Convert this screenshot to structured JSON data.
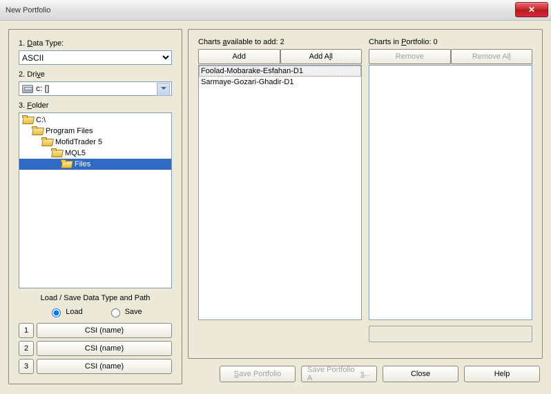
{
  "window": {
    "title": "New Portfolio"
  },
  "left": {
    "data_type_label": "1. Data Type:",
    "data_type_value": "ASCII",
    "drive_label": "2. Drive",
    "drive_value": "c: []",
    "folder_label": "3. Folder",
    "tree": [
      {
        "indent": 0,
        "label": "C:\\",
        "open": true,
        "selected": false
      },
      {
        "indent": 1,
        "label": "Program Files",
        "open": true,
        "selected": false
      },
      {
        "indent": 2,
        "label": "MofidTrader 5",
        "open": true,
        "selected": false
      },
      {
        "indent": 3,
        "label": "MQL5",
        "open": true,
        "selected": false
      },
      {
        "indent": 4,
        "label": "Files",
        "open": true,
        "selected": true
      }
    ],
    "load_save_title": "Load / Save Data Type and Path",
    "radio_load": "Load",
    "radio_save": "Save",
    "radio_selected": "load",
    "slots": [
      {
        "num": "1",
        "label": "CSI (name)"
      },
      {
        "num": "2",
        "label": "CSI (name)"
      },
      {
        "num": "3",
        "label": "CSI (name)"
      }
    ]
  },
  "right": {
    "available_label": "Charts available to add: 2",
    "add_label": "Add",
    "add_all_label": "Add All",
    "available_items": [
      "Foolad-Mobarake-Esfahan-D1",
      "Sarmaye-Gozari-Ghadir-D1"
    ],
    "portfolio_label": "Charts in Portfolio: 0",
    "remove_label": "Remove",
    "remove_all_label": "Remove All"
  },
  "buttons": {
    "save_portfolio": "Save Portfolio",
    "save_portfolio_as": "Save Portfolio As...",
    "close": "Close",
    "help": "Help"
  },
  "colors": {
    "selection": "#316ac5",
    "panel_bg": "#ece9d8",
    "close_btn": "#c8302c"
  }
}
